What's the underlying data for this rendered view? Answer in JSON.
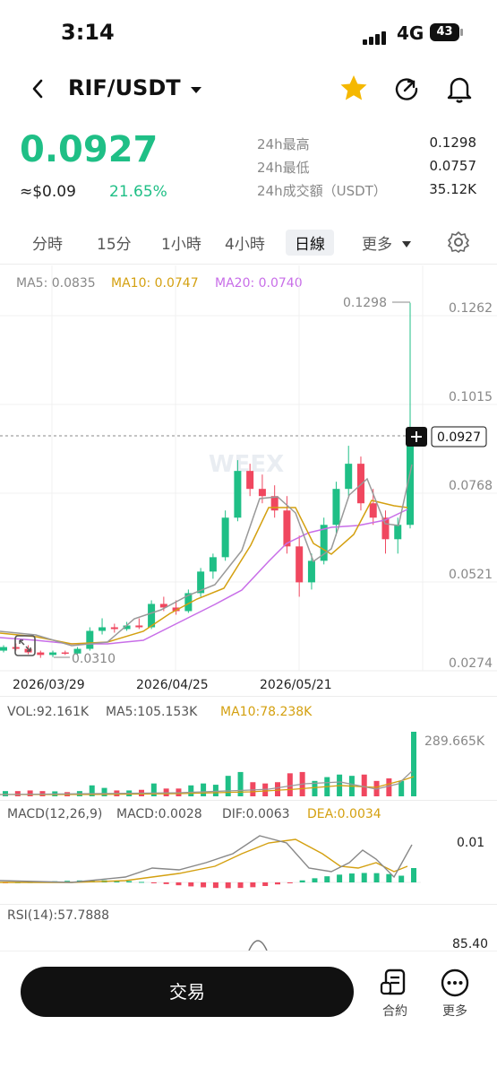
{
  "status": {
    "time": "3:14",
    "network": "4G",
    "battery": "43"
  },
  "header": {
    "pair": "RIF/USDT"
  },
  "ticker": {
    "price": "0.0927",
    "fiat": "≈$0.09",
    "change": "21.65%",
    "high_label": "24h最高",
    "high": "0.1298",
    "low_label": "24h最低",
    "low": "0.0757",
    "vol_label": "24h成交額（USDT）",
    "vol": "35.12K"
  },
  "timeframes": [
    "分時",
    "15分",
    "1小時",
    "4小時",
    "日線",
    "更多"
  ],
  "selected_timeframe": "日線",
  "main_chart": {
    "ma5": "MA5: 0.0835",
    "ma10": "MA10: 0.0747",
    "ma20": "MA20: 0.0740",
    "y_ticks": [
      "0.1262",
      "0.1015",
      "0.0768",
      "0.0521",
      "0.0274"
    ],
    "high_marker": "0.1298",
    "low_marker": "0.0310",
    "current_price": "0.0927",
    "x_ticks": [
      "2026/03/29",
      "2026/04/25",
      "2026/05/21"
    ],
    "watermark": "WEEX"
  },
  "vol_panel": {
    "vol": "VOL:92.161K",
    "ma5": "MA5:105.153K",
    "ma10": "MA10:78.238K",
    "y_tick": "289.665K"
  },
  "macd_panel": {
    "title": "MACD(12,26,9)",
    "macd": "MACD:0.0028",
    "dif": "DIF:0.0063",
    "dea": "DEA:0.0034",
    "y_tick": "0.01"
  },
  "rsi_panel": {
    "title": "RSI(14):57.7888",
    "y_tick": "85.40"
  },
  "footer": {
    "trade": "交易",
    "contract": "合約",
    "more": "更多"
  },
  "colors": {
    "up": "#1fbf86",
    "down": "#f0475f",
    "ma5": "#888888",
    "ma10": "#d4a010",
    "ma20": "#c86ee8"
  },
  "chart_data": {
    "type": "candlestick",
    "x": [
      "2026/03/29",
      "2026/04/25",
      "2026/05/21"
    ],
    "ohlc_approx": [
      [
        0.033,
        0.0345,
        0.0325,
        0.034
      ],
      [
        0.034,
        0.035,
        0.033,
        0.0335
      ],
      [
        0.0335,
        0.0345,
        0.032,
        0.0325
      ],
      [
        0.0325,
        0.033,
        0.031,
        0.0318
      ],
      [
        0.0318,
        0.033,
        0.0312,
        0.0325
      ],
      [
        0.0325,
        0.033,
        0.0318,
        0.0322
      ],
      [
        0.0322,
        0.034,
        0.032,
        0.0335
      ],
      [
        0.0335,
        0.0395,
        0.033,
        0.0385
      ],
      [
        0.0385,
        0.042,
        0.0375,
        0.0395
      ],
      [
        0.0395,
        0.0405,
        0.038,
        0.039
      ],
      [
        0.039,
        0.041,
        0.0385,
        0.04
      ],
      [
        0.04,
        0.042,
        0.039,
        0.0395
      ],
      [
        0.0395,
        0.047,
        0.039,
        0.046
      ],
      [
        0.046,
        0.048,
        0.044,
        0.045
      ],
      [
        0.045,
        0.047,
        0.043,
        0.044
      ],
      [
        0.044,
        0.05,
        0.0435,
        0.049
      ],
      [
        0.049,
        0.056,
        0.048,
        0.055
      ],
      [
        0.055,
        0.06,
        0.053,
        0.059
      ],
      [
        0.059,
        0.072,
        0.058,
        0.07
      ],
      [
        0.07,
        0.086,
        0.069,
        0.083
      ],
      [
        0.083,
        0.085,
        0.076,
        0.078
      ],
      [
        0.078,
        0.082,
        0.074,
        0.076
      ],
      [
        0.076,
        0.079,
        0.07,
        0.072
      ],
      [
        0.072,
        0.076,
        0.06,
        0.062
      ],
      [
        0.062,
        0.065,
        0.048,
        0.052
      ],
      [
        0.052,
        0.06,
        0.05,
        0.058
      ],
      [
        0.058,
        0.07,
        0.057,
        0.068
      ],
      [
        0.068,
        0.08,
        0.065,
        0.078
      ],
      [
        0.078,
        0.09,
        0.076,
        0.085
      ],
      [
        0.085,
        0.087,
        0.072,
        0.074
      ],
      [
        0.074,
        0.078,
        0.068,
        0.07
      ],
      [
        0.07,
        0.072,
        0.06,
        0.064
      ],
      [
        0.064,
        0.07,
        0.06,
        0.068
      ],
      [
        0.068,
        0.1298,
        0.067,
        0.0927
      ]
    ],
    "ylim": [
      0.0274,
      0.1262
    ]
  }
}
